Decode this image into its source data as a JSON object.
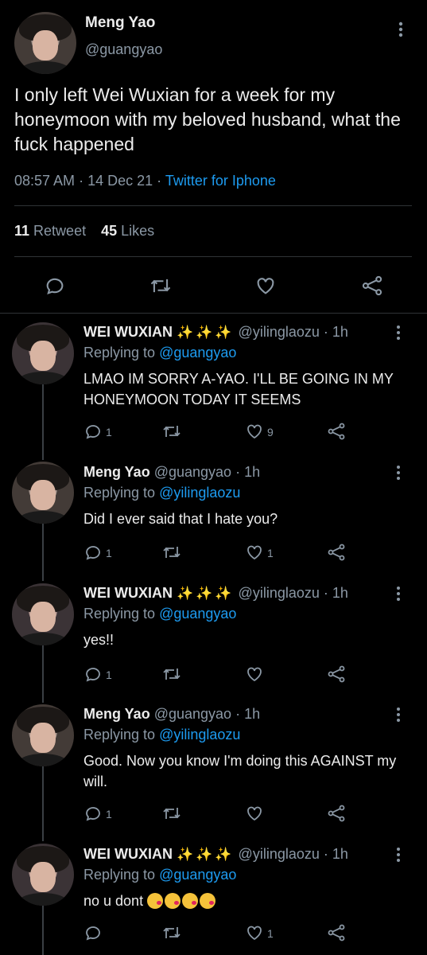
{
  "main": {
    "name": "Meng Yao",
    "handle": "@guangyao",
    "text": "I only left Wei Wuxian for a week for my honeymoon with my beloved husband, what the fuck happened",
    "time": "08:57 AM",
    "date": "14 Dec 21",
    "source": "Twitter for Iphone",
    "retweet_count": "11",
    "retweet_label": "Retweet",
    "likes_count": "45",
    "likes_label": "Likes"
  },
  "replies": [
    {
      "name": "WEI WUXIAN",
      "sparkles": "✨✨✨",
      "handle": "@yilinglaozu",
      "time": "1h",
      "replying_label": "Replying to",
      "replying_to": "@guangyao",
      "text": "LMAO IM SORRY A-YAO. I'LL BE GOING IN MY HONEYMOON TODAY IT SEEMS",
      "reply_count": "1",
      "like_count": "9"
    },
    {
      "name": "Meng Yao",
      "handle": "@guangyao",
      "time": "1h",
      "replying_label": "Replying to",
      "replying_to": "@yilinglaozu",
      "text": "Did I ever said that I hate you?",
      "reply_count": "1",
      "like_count": "1"
    },
    {
      "name": "WEI WUXIAN",
      "sparkles": "✨✨✨",
      "handle": "@yilinglaozu",
      "time": "1h",
      "replying_label": "Replying to",
      "replying_to": "@guangyao",
      "text": "yes!!",
      "reply_count": "1",
      "like_count": ""
    },
    {
      "name": "Meng Yao",
      "handle": "@guangyao",
      "time": "1h",
      "replying_label": "Replying to",
      "replying_to": "@yilinglaozu",
      "text": "Good. Now you know I'm doing this AGAINST my will.",
      "reply_count": "1",
      "like_count": ""
    },
    {
      "name": "WEI WUXIAN",
      "sparkles": "✨✨✨",
      "handle": "@yilinglaozu",
      "time": "1h",
      "replying_label": "Replying to",
      "replying_to": "@guangyao",
      "text": "no u dont",
      "reply_count": "",
      "like_count": "1"
    }
  ],
  "colors": {
    "background": "#000000",
    "link": "#1d9bf0",
    "muted": "#8b98a5",
    "sparkle": "#f7c948"
  },
  "icons": [
    "kebab-icon",
    "reply-icon",
    "retweet-icon",
    "like-icon",
    "share-icon"
  ]
}
